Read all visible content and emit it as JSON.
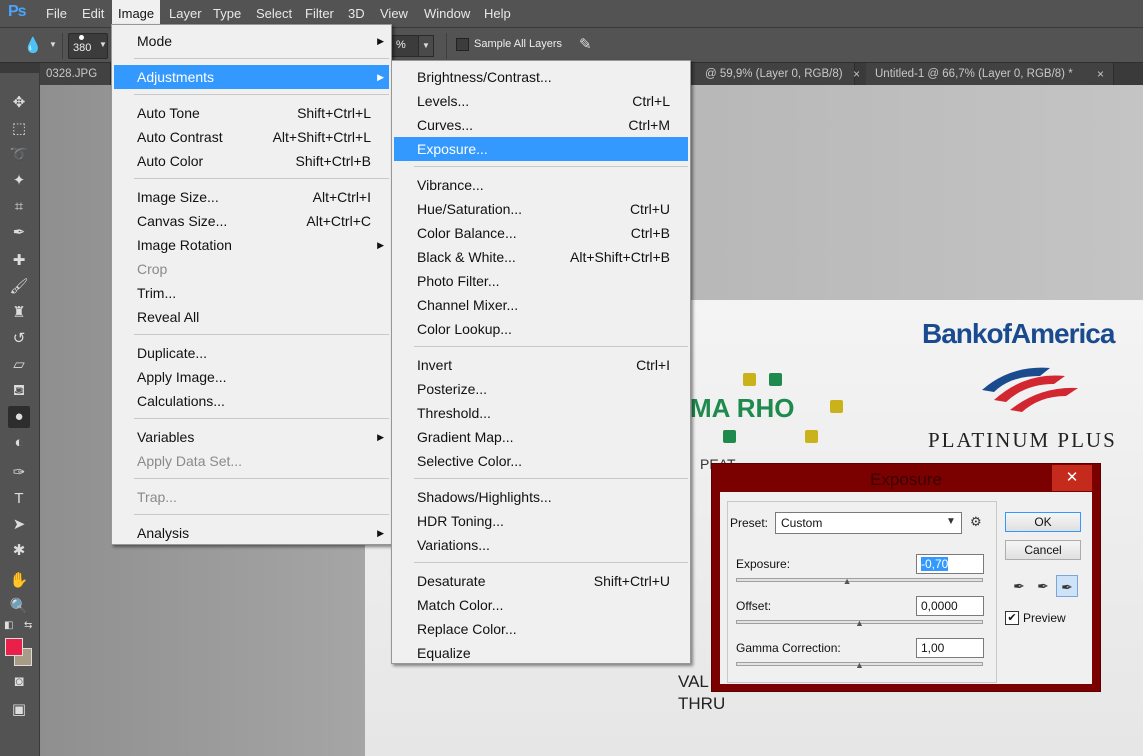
{
  "app": {
    "logo": "Ps"
  },
  "menubar": {
    "items": [
      "File",
      "Edit",
      "Image",
      "Layer",
      "Type",
      "Select",
      "Filter",
      "3D",
      "View",
      "Window",
      "Help"
    ],
    "active": "Image"
  },
  "options": {
    "brush_size": "380",
    "percent_suffix": "%",
    "sample_all_layers": "Sample All Layers"
  },
  "tabs": [
    {
      "label": "0328.JPG @",
      "close": ""
    },
    {
      "label": "@ 59,9% (Layer 0, RGB/8) *",
      "close": "×"
    },
    {
      "label": "Untitled-1 @ 66,7% (Layer 0, RGB/8) *",
      "close": "×"
    }
  ],
  "image_menu": {
    "groups": [
      [
        {
          "label": "Mode",
          "shortcut": "",
          "submenu": true
        }
      ],
      [
        {
          "label": "Adjustments",
          "shortcut": "",
          "submenu": true,
          "highlight": true
        }
      ],
      [
        {
          "label": "Auto Tone",
          "shortcut": "Shift+Ctrl+L"
        },
        {
          "label": "Auto Contrast",
          "shortcut": "Alt+Shift+Ctrl+L"
        },
        {
          "label": "Auto Color",
          "shortcut": "Shift+Ctrl+B"
        }
      ],
      [
        {
          "label": "Image Size...",
          "shortcut": "Alt+Ctrl+I"
        },
        {
          "label": "Canvas Size...",
          "shortcut": "Alt+Ctrl+C"
        },
        {
          "label": "Image Rotation",
          "shortcut": "",
          "submenu": true
        },
        {
          "label": "Crop",
          "shortcut": "",
          "disabled": true
        },
        {
          "label": "Trim...",
          "shortcut": ""
        },
        {
          "label": "Reveal All",
          "shortcut": ""
        }
      ],
      [
        {
          "label": "Duplicate...",
          "shortcut": ""
        },
        {
          "label": "Apply Image...",
          "shortcut": ""
        },
        {
          "label": "Calculations...",
          "shortcut": ""
        }
      ],
      [
        {
          "label": "Variables",
          "shortcut": "",
          "submenu": true
        },
        {
          "label": "Apply Data Set...",
          "shortcut": "",
          "disabled": true
        }
      ],
      [
        {
          "label": "Trap...",
          "shortcut": "",
          "disabled": true
        }
      ],
      [
        {
          "label": "Analysis",
          "shortcut": "",
          "submenu": true
        }
      ]
    ]
  },
  "adjustments_menu": {
    "groups": [
      [
        {
          "label": "Brightness/Contrast...",
          "shortcut": ""
        },
        {
          "label": "Levels...",
          "shortcut": "Ctrl+L"
        },
        {
          "label": "Curves...",
          "shortcut": "Ctrl+M"
        },
        {
          "label": "Exposure...",
          "shortcut": "",
          "highlight": true
        }
      ],
      [
        {
          "label": "Vibrance...",
          "shortcut": ""
        },
        {
          "label": "Hue/Saturation...",
          "shortcut": "Ctrl+U"
        },
        {
          "label": "Color Balance...",
          "shortcut": "Ctrl+B"
        },
        {
          "label": "Black & White...",
          "shortcut": "Alt+Shift+Ctrl+B"
        },
        {
          "label": "Photo Filter...",
          "shortcut": ""
        },
        {
          "label": "Channel Mixer...",
          "shortcut": ""
        },
        {
          "label": "Color Lookup...",
          "shortcut": ""
        }
      ],
      [
        {
          "label": "Invert",
          "shortcut": "Ctrl+I"
        },
        {
          "label": "Posterize...",
          "shortcut": ""
        },
        {
          "label": "Threshold...",
          "shortcut": ""
        },
        {
          "label": "Gradient Map...",
          "shortcut": ""
        },
        {
          "label": "Selective Color...",
          "shortcut": ""
        }
      ],
      [
        {
          "label": "Shadows/Highlights...",
          "shortcut": ""
        },
        {
          "label": "HDR Toning...",
          "shortcut": ""
        },
        {
          "label": "Variations...",
          "shortcut": ""
        }
      ],
      [
        {
          "label": "Desaturate",
          "shortcut": "Shift+Ctrl+U"
        },
        {
          "label": "Match Color...",
          "shortcut": ""
        },
        {
          "label": "Replace Color...",
          "shortcut": ""
        },
        {
          "label": "Equalize",
          "shortcut": ""
        }
      ]
    ]
  },
  "canvas": {
    "boa": "BankofAmerica",
    "platinum": "PLATINUM PLUS",
    "rho": "MA RHO",
    "peat": "PEAT",
    "val": "VAL",
    "thru": "THRU"
  },
  "exposure_dialog": {
    "title": "Exposure",
    "close": "✕",
    "preset_label": "Preset:",
    "preset_value": "Custom",
    "exposure_label": "Exposure:",
    "exposure_value": "-0,70",
    "exposure_level": 0.45,
    "offset_label": "Offset:",
    "offset_value": "0,0000",
    "offset_level": 0.5,
    "gamma_label": "Gamma Correction:",
    "gamma_value": "1,00",
    "gamma_level": 0.5,
    "ok": "OK",
    "cancel": "Cancel",
    "preview_label": "Preview",
    "preview_checked": true
  },
  "colors": {
    "foreground": "#e8204a",
    "background": "#a89c86",
    "highlight": "#3399ff",
    "dialog_frame": "#7b0000"
  }
}
